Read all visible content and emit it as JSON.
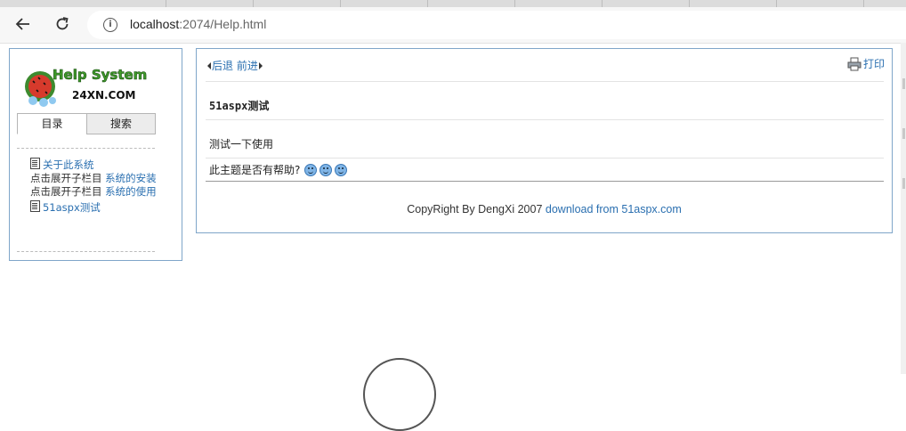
{
  "browser": {
    "back_icon": "arrow-left-icon",
    "reload_icon": "reload-icon",
    "info_icon": "info-icon",
    "url_host": "localhost",
    "url_rest": ":2074/Help.html"
  },
  "sidebar": {
    "logo_title": "Help System",
    "logo_sub": "24XN.COM",
    "tabs": [
      {
        "label": "目录"
      },
      {
        "label": "搜索"
      }
    ],
    "tree": [
      {
        "label": "关于此系统",
        "icon": "document-icon"
      },
      {
        "alt": "点击展开子栏目",
        "label": "系统的安装"
      },
      {
        "alt": "点击展开子栏目",
        "label": "系统的使用"
      },
      {
        "label": "51aspx测试",
        "icon": "document-icon"
      }
    ]
  },
  "content": {
    "back_label": "后退",
    "forward_label": "前进",
    "print_label": "打印",
    "title": "51aspx测试",
    "body": "测试一下使用",
    "feedback_question": "此主题是否有帮助?",
    "copyright": "CopyRight By DengXi 2007",
    "download_link": "download from 51aspx.com"
  },
  "colors": {
    "link": "#2a6fb0",
    "panel_border": "#7fa6c9"
  }
}
